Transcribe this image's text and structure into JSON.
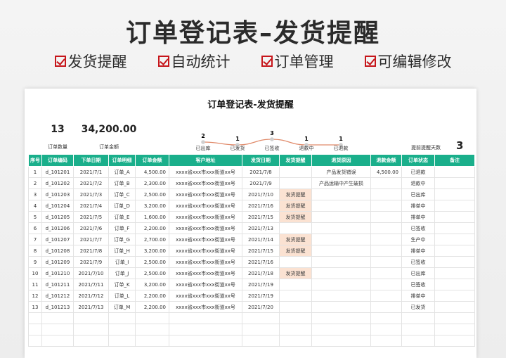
{
  "banner": {
    "title": "订单登记表–发货提醒",
    "features": [
      "发货提醒",
      "自动统计",
      "订单管理",
      "可编辑修改"
    ]
  },
  "sheet": {
    "title": "订单登记表-发货提醒",
    "order_count": "13",
    "order_count_label": "订单数量",
    "order_amount": "34,200.00",
    "order_amount_label": "订单金额",
    "remind_label": "提前提醒天数",
    "remind_days": "3"
  },
  "status_chart": {
    "values_text": [
      "2",
      "1",
      "3",
      "1",
      "1"
    ],
    "labels": [
      "已出库",
      "已发货",
      "已签收",
      "退款中",
      "已退款"
    ],
    "line_color": "#e08a6a"
  },
  "chart_data": {
    "type": "line",
    "categories": [
      "已出库",
      "已发货",
      "已签收",
      "退款中",
      "已退款"
    ],
    "values": [
      2,
      1,
      3,
      1,
      1
    ]
  },
  "table": {
    "headers": [
      "序号",
      "订单编码",
      "下单日期",
      "订单明细",
      "订单金额",
      "客户地址",
      "发货日期",
      "发货提醒",
      "退货原因",
      "退款金额",
      "订单状态",
      "备注"
    ],
    "rows": [
      [
        "1",
        "d_101201",
        "2021/7/1",
        "订单_A",
        "4,500.00",
        "xxxx省xxx市xxx街道xx号",
        "2021/7/8",
        "",
        "产品发货错误",
        "4,500.00",
        "已退款",
        ""
      ],
      [
        "2",
        "d_101202",
        "2021/7/2",
        "订单_B",
        "2,300.00",
        "xxxx省xxx市xxx街道xx号",
        "2021/7/9",
        "",
        "产品运输中产生破损",
        "",
        "退款中",
        ""
      ],
      [
        "3",
        "d_101203",
        "2021/7/3",
        "订单_C",
        "2,500.00",
        "xxxx省xxx市xxx街道xx号",
        "2021/7/10",
        "发货提醒",
        "",
        "",
        "已出库",
        ""
      ],
      [
        "4",
        "d_101204",
        "2021/7/4",
        "订单_D",
        "3,200.00",
        "xxxx省xxx市xxx街道xx号",
        "2021/7/16",
        "发货提醒",
        "",
        "",
        "排单中",
        ""
      ],
      [
        "5",
        "d_101205",
        "2021/7/5",
        "订单_E",
        "1,600.00",
        "xxxx省xxx市xxx街道xx号",
        "2021/7/15",
        "发货提醒",
        "",
        "",
        "排单中",
        ""
      ],
      [
        "6",
        "d_101206",
        "2021/7/6",
        "订单_F",
        "2,200.00",
        "xxxx省xxx市xxx街道xx号",
        "2021/7/13",
        "",
        "",
        "",
        "已签收",
        ""
      ],
      [
        "7",
        "d_101207",
        "2021/7/7",
        "订单_G",
        "2,700.00",
        "xxxx省xxx市xxx街道xx号",
        "2021/7/14",
        "发货提醒",
        "",
        "",
        "生产中",
        ""
      ],
      [
        "8",
        "d_101208",
        "2021/7/8",
        "订单_H",
        "3,200.00",
        "xxxx省xxx市xxx街道xx号",
        "2021/7/15",
        "发货提醒",
        "",
        "",
        "排单中",
        ""
      ],
      [
        "9",
        "d_101209",
        "2021/7/9",
        "订单_I",
        "2,500.00",
        "xxxx省xxx市xxx街道xx号",
        "2021/7/16",
        "",
        "",
        "",
        "已签收",
        ""
      ],
      [
        "10",
        "d_101210",
        "2021/7/10",
        "订单_J",
        "2,500.00",
        "xxxx省xxx市xxx街道xx号",
        "2021/7/18",
        "发货提醒",
        "",
        "",
        "已出库",
        ""
      ],
      [
        "11",
        "d_101211",
        "2021/7/11",
        "订单_K",
        "3,200.00",
        "xxxx省xxx市xxx街道xx号",
        "2021/7/19",
        "",
        "",
        "",
        "已签收",
        ""
      ],
      [
        "12",
        "d_101212",
        "2021/7/12",
        "订单_L",
        "2,200.00",
        "xxxx省xxx市xxx街道xx号",
        "2021/7/19",
        "",
        "",
        "",
        "排单中",
        ""
      ],
      [
        "13",
        "d_101213",
        "2021/7/13",
        "订单_M",
        "2,200.00",
        "xxxx省xxx市xxx街道xx号",
        "2021/7/20",
        "",
        "",
        "",
        "已发货",
        ""
      ]
    ],
    "empty_rows": 3,
    "remind_color": "#fbe2d2",
    "header_color": "#1aaf8b"
  }
}
